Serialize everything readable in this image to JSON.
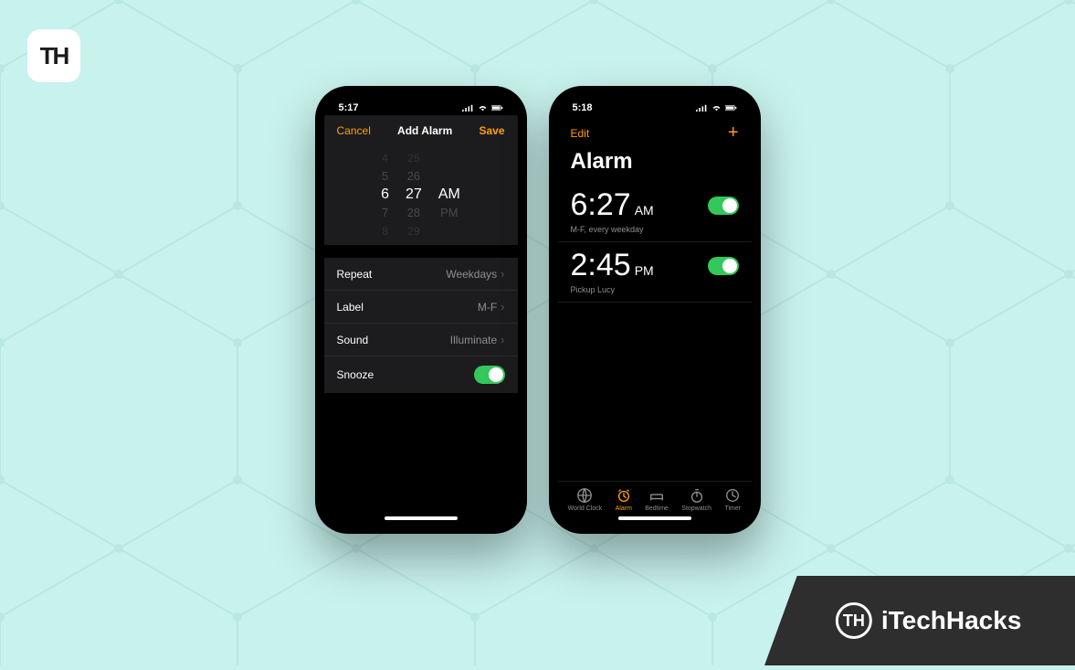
{
  "brand": {
    "name": "iTechHacks",
    "logo_text": "TH"
  },
  "phone_left": {
    "status_time": "5:17",
    "header": {
      "cancel": "Cancel",
      "title": "Add Alarm",
      "save": "Save"
    },
    "picker": {
      "hours": [
        "4",
        "5",
        "6",
        "7",
        "8"
      ],
      "minutes": [
        "25",
        "26",
        "27",
        "28",
        "29"
      ],
      "ampm": [
        "AM",
        "PM"
      ],
      "selected_hour": "6",
      "selected_minute": "27",
      "selected_ampm": "AM"
    },
    "settings": {
      "repeat_label": "Repeat",
      "repeat_value": "Weekdays",
      "label_label": "Label",
      "label_value": "M-F",
      "sound_label": "Sound",
      "sound_value": "Illuminate",
      "snooze_label": "Snooze",
      "snooze_on": true
    }
  },
  "phone_right": {
    "status_time": "5:18",
    "nav": {
      "edit": "Edit",
      "add": "+"
    },
    "title": "Alarm",
    "alarms": [
      {
        "time": "6:27",
        "ampm": "AM",
        "sub": "M-F, every weekday",
        "on": true
      },
      {
        "time": "2:45",
        "ampm": "PM",
        "sub": "Pickup Lucy",
        "on": true
      }
    ],
    "tabs": [
      {
        "label": "World Clock",
        "active": false
      },
      {
        "label": "Alarm",
        "active": true
      },
      {
        "label": "Bedtime",
        "active": false
      },
      {
        "label": "Stopwatch",
        "active": false
      },
      {
        "label": "Timer",
        "active": false
      }
    ]
  }
}
